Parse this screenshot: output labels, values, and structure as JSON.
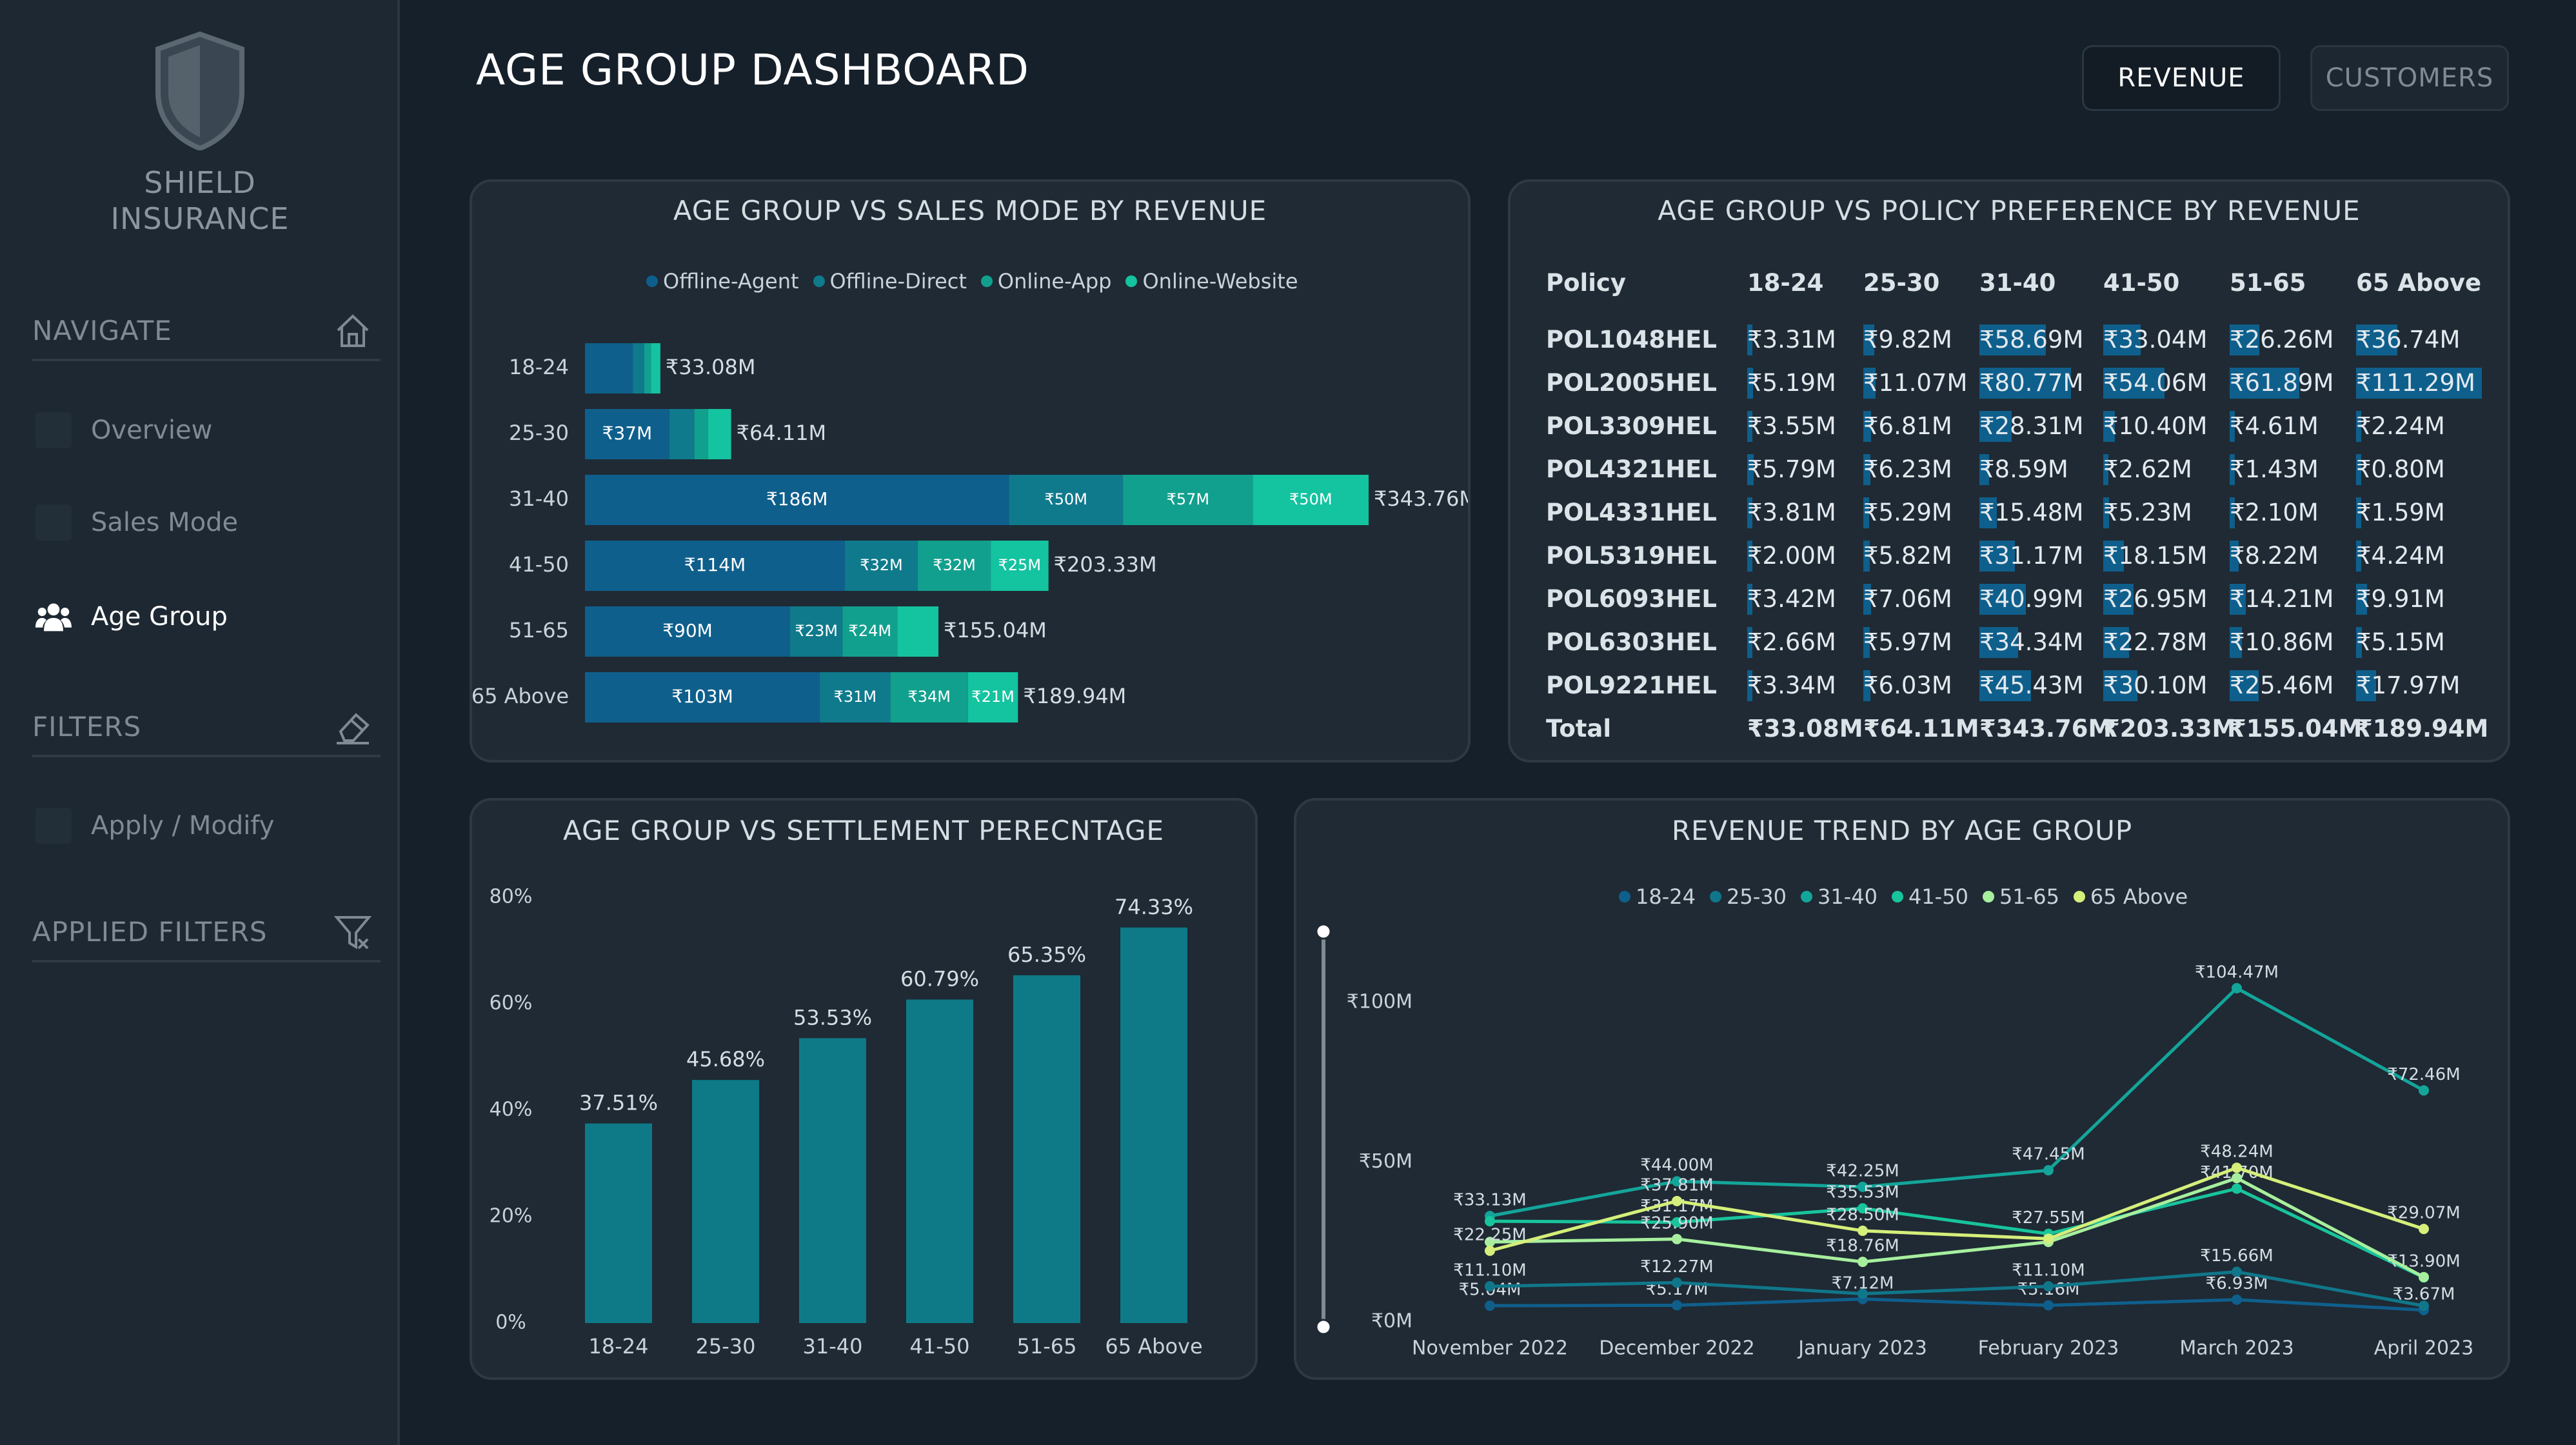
{
  "sidebar": {
    "brand_line1": "SHIELD",
    "brand_line2": "INSURANCE",
    "navigate_label": "NAVIGATE",
    "nav_items": [
      {
        "label": "Overview",
        "active": false
      },
      {
        "label": "Sales Mode",
        "active": false
      },
      {
        "label": "Age Group",
        "active": true
      }
    ],
    "filters_label": "FILTERS",
    "filter_items": [
      {
        "label": "Apply / Modify"
      }
    ],
    "applied_filters_label": "APPLIED FILTERS"
  },
  "header": {
    "title": "AGE GROUP DASHBOARD",
    "revenue_button": "REVENUE",
    "customers_button": "CUSTOMERS"
  },
  "colors": {
    "offline_agent": "#0f5f8c",
    "offline_direct": "#0f7a8c",
    "online_app": "#12a08e",
    "online_website": "#14c3a0"
  },
  "sales_mode_chart": {
    "title": "AGE GROUP VS SALES MODE BY REVENUE",
    "chart_data": {
      "type": "bar",
      "orientation": "horizontal-stacked",
      "categories": [
        "18-24",
        "25-30",
        "31-40",
        "41-50",
        "51-65",
        "65 Above"
      ],
      "series": [
        {
          "name": "Offline-Agent",
          "values": [
            21,
            37,
            186,
            114,
            90,
            103
          ],
          "labels": [
            "",
            "₹37M",
            "₹186M",
            "₹114M",
            "₹90M",
            "₹103M"
          ]
        },
        {
          "name": "Offline-Direct",
          "values": [
            5,
            11,
            50,
            32,
            23,
            31
          ],
          "labels": [
            "",
            "",
            "₹50M",
            "₹32M",
            "₹23M",
            "₹31M"
          ]
        },
        {
          "name": "Online-App",
          "values": [
            3,
            6,
            57,
            32,
            24,
            34
          ],
          "labels": [
            "",
            "",
            "₹57M",
            "₹32M",
            "₹24M",
            "₹34M"
          ]
        },
        {
          "name": "Online-Website",
          "values": [
            4.08,
            10.11,
            50.76,
            25.33,
            18.04,
            21.94
          ],
          "labels": [
            "",
            "",
            "₹50M",
            "₹25M",
            "",
            "₹21M"
          ]
        }
      ],
      "totals": [
        "₹33.08M",
        "₹64.11M",
        "₹343.76M",
        "₹203.33M",
        "₹155.04M",
        "₹189.94M"
      ]
    }
  },
  "policy_matrix": {
    "title": "AGE GROUP VS POLICY PREFERENCE BY REVENUE",
    "columns": [
      "Policy",
      "18-24",
      "25-30",
      "31-40",
      "41-50",
      "51-65",
      "65 Above"
    ],
    "rows": [
      {
        "policy": "POL1048HEL",
        "values": [
          "₹3.31M",
          "₹9.82M",
          "₹58.69M",
          "₹33.04M",
          "₹26.26M",
          "₹36.74M"
        ],
        "nums": [
          3.31,
          9.82,
          58.69,
          33.04,
          26.26,
          36.74
        ]
      },
      {
        "policy": "POL2005HEL",
        "values": [
          "₹5.19M",
          "₹11.07M",
          "₹80.77M",
          "₹54.06M",
          "₹61.89M",
          "₹111.29M"
        ],
        "nums": [
          5.19,
          11.07,
          80.77,
          54.06,
          61.89,
          111.29
        ]
      },
      {
        "policy": "POL3309HEL",
        "values": [
          "₹3.55M",
          "₹6.81M",
          "₹28.31M",
          "₹10.40M",
          "₹4.61M",
          "₹2.24M"
        ],
        "nums": [
          3.55,
          6.81,
          28.31,
          10.4,
          4.61,
          2.24
        ]
      },
      {
        "policy": "POL4321HEL",
        "values": [
          "₹5.79M",
          "₹6.23M",
          "₹8.59M",
          "₹2.62M",
          "₹1.43M",
          "₹0.80M"
        ],
        "nums": [
          5.79,
          6.23,
          8.59,
          2.62,
          1.43,
          0.8
        ]
      },
      {
        "policy": "POL4331HEL",
        "values": [
          "₹3.81M",
          "₹5.29M",
          "₹15.48M",
          "₹5.23M",
          "₹2.10M",
          "₹1.59M"
        ],
        "nums": [
          3.81,
          5.29,
          15.48,
          5.23,
          2.1,
          1.59
        ]
      },
      {
        "policy": "POL5319HEL",
        "values": [
          "₹2.00M",
          "₹5.82M",
          "₹31.17M",
          "₹18.15M",
          "₹8.22M",
          "₹4.24M"
        ],
        "nums": [
          2.0,
          5.82,
          31.17,
          18.15,
          8.22,
          4.24
        ]
      },
      {
        "policy": "POL6093HEL",
        "values": [
          "₹3.42M",
          "₹7.06M",
          "₹40.99M",
          "₹26.95M",
          "₹14.21M",
          "₹9.91M"
        ],
        "nums": [
          3.42,
          7.06,
          40.99,
          26.95,
          14.21,
          9.91
        ]
      },
      {
        "policy": "POL6303HEL",
        "values": [
          "₹2.66M",
          "₹5.97M",
          "₹34.34M",
          "₹22.78M",
          "₹10.86M",
          "₹5.15M"
        ],
        "nums": [
          2.66,
          5.97,
          34.34,
          22.78,
          10.86,
          5.15
        ]
      },
      {
        "policy": "POL9221HEL",
        "values": [
          "₹3.34M",
          "₹6.03M",
          "₹45.43M",
          "₹30.10M",
          "₹25.46M",
          "₹17.97M"
        ],
        "nums": [
          3.34,
          6.03,
          45.43,
          30.1,
          25.46,
          17.97
        ]
      }
    ],
    "total": {
      "label": "Total",
      "values": [
        "₹33.08M",
        "₹64.11M",
        "₹343.76M",
        "₹203.33M",
        "₹155.04M",
        "₹189.94M"
      ]
    }
  },
  "settlement_chart": {
    "title": "AGE GROUP VS SETTLEMENT PERECNTAGE",
    "chart_data": {
      "type": "bar",
      "categories": [
        "18-24",
        "25-30",
        "31-40",
        "41-50",
        "51-65",
        "65 Above"
      ],
      "values": [
        37.51,
        45.68,
        53.53,
        60.79,
        65.35,
        74.33
      ],
      "labels": [
        "37.51%",
        "45.68%",
        "53.53%",
        "60.79%",
        "65.35%",
        "74.33%"
      ],
      "yticks": [
        "0%",
        "20%",
        "40%",
        "60%",
        "80%"
      ],
      "ylim": [
        0,
        80
      ],
      "color": "#0e7a88"
    }
  },
  "trend_chart": {
    "title": "REVENUE TREND BY AGE GROUP",
    "chart_data": {
      "type": "line",
      "x": [
        "November 2022",
        "December 2022",
        "January 2023",
        "February 2023",
        "March 2023",
        "April 2023"
      ],
      "yticks": [
        "₹0M",
        "₹50M",
        "₹100M"
      ],
      "ylim": [
        0,
        105
      ],
      "series": [
        {
          "name": "18-24",
          "color": "#0f5f8c",
          "values": [
            5.04,
            5.17,
            7.12,
            5.16,
            6.93,
            3.67
          ],
          "labels": [
            "₹5.04M",
            "₹5.17M",
            "₹7.12M",
            "₹5.16M",
            "₹6.93M",
            "₹3.67M"
          ]
        },
        {
          "name": "25-30",
          "color": "#10778a",
          "values": [
            11.1,
            12.27,
            8.8,
            11.1,
            15.66,
            5.0
          ],
          "labels": [
            "₹11.10M",
            "₹12.27M",
            "",
            "₹11.10M",
            "₹15.66M",
            ""
          ]
        },
        {
          "name": "31-40",
          "color": "#14a59a",
          "values": [
            33.13,
            44.0,
            42.25,
            47.45,
            104.47,
            72.46
          ],
          "labels": [
            "₹33.13M",
            "₹44.00M",
            "₹42.25M",
            "₹47.45M",
            "₹104.47M",
            "₹72.46M"
          ]
        },
        {
          "name": "41-50",
          "color": "#18c49c",
          "values": [
            31.5,
            31.17,
            35.53,
            27.55,
            41.7,
            13.9
          ],
          "labels": [
            "",
            "₹31.17M",
            "₹35.53M",
            "₹27.55M",
            "₹41.70M",
            "₹13.90M"
          ]
        },
        {
          "name": "51-65",
          "color": "#a7ef9e",
          "values": [
            25.0,
            25.9,
            18.76,
            25.0,
            45.0,
            14.0
          ],
          "labels": [
            "",
            "₹25.90M",
            "₹18.76M",
            "",
            "",
            ""
          ]
        },
        {
          "name": "65 Above",
          "color": "#d5ef7a",
          "values": [
            22.25,
            37.81,
            28.5,
            26.0,
            48.24,
            29.07
          ],
          "labels": [
            "₹22.25M",
            "₹37.81M",
            "₹28.50M",
            "",
            "₹48.24M",
            "₹29.07M"
          ]
        }
      ]
    }
  }
}
